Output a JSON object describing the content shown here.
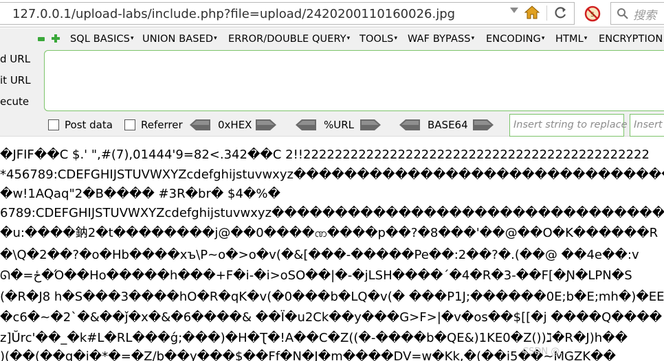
{
  "browser": {
    "url": "127.0.0.1/upload-labs/include.php?file=upload/2420200110160026.jpg",
    "search_placeholder": "搜索"
  },
  "hackbar": {
    "menu": [
      {
        "label": "SQL BASICS",
        "x": 0
      },
      {
        "label": "UNION BASED"
      },
      {
        "label": "ERROR/DOUBLE QUERY"
      },
      {
        "label": "TOOLS"
      },
      {
        "label": "WAF BYPASS"
      },
      {
        "label": "ENCODING"
      },
      {
        "label": "HTML"
      },
      {
        "label": "ENCRYPTION"
      }
    ],
    "side_buttons": [
      "d URL",
      "it URL",
      "ecute"
    ],
    "url_value": "",
    "options": {
      "post_data": "Post data",
      "referrer": "Referrer",
      "hex": "0xHEX",
      "url": "%URL",
      "base64": "BASE64"
    },
    "insert_replace_placeholder": "Insert string to replace",
    "insert_placeholder": "Insert"
  },
  "content": {
    "lines": [
      "�JFIF��C    $.' \",#(7),01444'9=82<.342��C  2!!22222222222222222222222222222222222222222222",
      "*456789:CDEFGHIJSTUVWXYZcdefghijstuvwxyz�����������������������������������������",
      "�w!1AQaq\"2�B���� #3R�br� $4�%�",
      "6789:CDEFGHIJSTUVWXYZcdefghijstuvwxyz��������������������������������������������",
      "�u:����鈉2�t��������j@��0����ဏ����p��?�8���'��@��O�K������R",
      "�\\Q�2��?�o�Hb����xъ\\P~o�>o�v(�&[���-�����Pe��:2��?�.(��@ ��4e��:v",
      "ᘏ�=ځ�Ό��Ho�����h���+F�i-�i>oSO��|�-�jLSH����΄�4�R�3-��F[�Ɲ�LPN�S",
      "(�R�J8 h�S���3����hO�R�qK�v(�0���b�LQ�v(� ���P1J;������0E;b�E;mh�)�EE",
      "�c6�~�2`�&��ǰ�x�&�6����& ��Ï�u2Ck��y���G>F>|�v�os��$[[�j ����Q����",
      "z]Ŭrc'��_�k#L�RL���ǵ;���)�H�Ʈ�!A��C�Z((�-����b�QE&)1KE0�Z())ℷ�R�J)h��",
      ")(��(��q�i�*�=�Z/b��y���$��Ff�N�J�m����DV=w�Kk,�(��i5��~MGZK��"
    ],
    "watermark": "CSDN @..."
  }
}
